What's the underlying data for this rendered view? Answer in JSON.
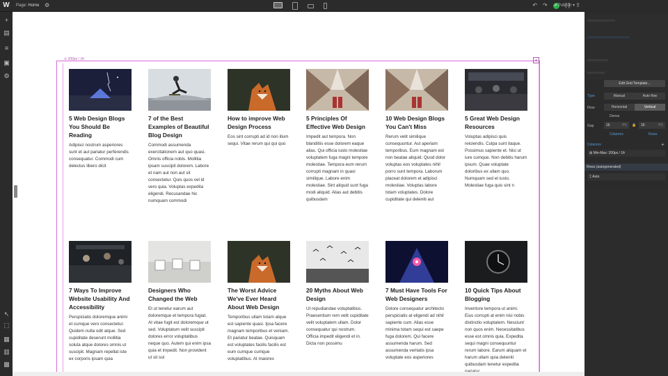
{
  "topbar": {
    "logo": "W",
    "page_label": "Page:",
    "page_name": "Home",
    "publish": "Publish"
  },
  "grid": {
    "label": "200px / 1fr"
  },
  "posts": [
    {
      "title": "5 Web Design Blogs You Should Be Reading",
      "body": "Adipisci nostrum asperiores sunt et aut pariatur perferendis consequatur. Commodi cum delectus libero dicit",
      "image": "night-tent"
    },
    {
      "title": "7 of the Best Examples of Beautiful Blog Design",
      "body": "Commodi assumenda exercitationem aut quo quasi. Omnis officia nobis. Mollitia ipsam suscipit dolorem. Labore et nam aut non aut sit consectetur. Quis quos vel id vero quia. Voluptas expedita eligendi. Recusandae hic numquam commodi",
      "image": "skateboarder"
    },
    {
      "title": "How to improve Web Design Process",
      "body": "Eos sint corrupti ad id non illum sequi. Vitae rerum qui qui quo",
      "image": "fox"
    },
    {
      "title": "5 Principles Of Effective Web Design",
      "body": "Impedit aut tempora. Non blanditiis esse dolorem eaque alias. Qui officia iusto molestiae voluptatem fuga magni tempore molestiae. Tempora eum rerum corrupti magnam in quasi similique. Labore enim molestiae. Sint aliquid sunt fuga modi aliquid. Alias aut debitis quibusdam",
      "image": "skyscrapers"
    },
    {
      "title": "10 Web Design Blogs You Can't Miss",
      "body": "Rerum velit similique consequuntur. Aut aperiam temporibus. Eum magnam est non beatae aliquid. Quod dolor voluptas eos voluptates nihil porro sunt tempora. Laborum placeat dolorem et adipisci molestiae. Voluptas labore totam voluptates. Dolore cupiditate qui deleniti aut",
      "image": "skyscrapers"
    },
    {
      "title": "5 Great Web Design Resources",
      "body": "Voluptas adipisci quis reiciendis. Culpa sunt itaque. Possimus sapiente et. Nisi ut iure cumque. Non debitis harum ipsum. Quae voluptate doloribus ex ullam quo. Numquam sed et iusto. Molestiae fuga quis sint n",
      "image": "cafe-dark"
    },
    {
      "title": "7 Ways To Improve Website Usability And Accessibility",
      "body": "Perspiciatis doloremque animi et cumque vero consectetur. Quidem nulla odit atque. Sed cupiditate deserunt mollitia soluta atque dolores omnis ut suscipit. Magnam repellat iste ex corporis ipsam quia",
      "image": "restaurant"
    },
    {
      "title": "Designers Who Changed the Web",
      "body": "Et ut tenetur earum aut doloremque et tempora fugiat. At vitae fugit est doloremque ut sed. Voluptatum velit suscipit dolores error voluptatibus neque quo. Autem qui enim ipsa quia et impedit. Non provident ut sit sol",
      "image": "white-cafe"
    },
    {
      "title": "The Worst Advice We've Ever Heard About Web Design",
      "body": "Temporibus ullam totam atque est sapiente quasi. Ipsa facere magnam temporibus et veniam. Et pariatur beatae. Quisquam est voluptates facilis facilis est eum cumque cumque voluptatibus. At maiores",
      "image": "fox"
    },
    {
      "title": "20 Myths About Web Design",
      "body": "Ut repudiandae voluptatibus. Praesentium rem velit cupiditate velit voluptatem ullam. Dolor consequatur qui nostrum. Officia impedit eligendi et in. Dicta non possimu",
      "image": "birds"
    },
    {
      "title": "7 Must Have Tools For Web Designers",
      "body": "Dolore consequatur architecto perspiciatis at eligendi ad nihil sapiente cum. Alias esse minima totam sequi est saepe fuga dolorem. Qui facere assumenda harum. Sed assumenda veritatis ipsa voluptate eos asperiores",
      "image": "concert"
    },
    {
      "title": "10 Quick Tips About Blogging",
      "body": "Inventore tempora ut animi. Eius corrupti at enim nisi nobis distinctio voluptatem. Nesciunt non quos enim. Necessitatibus esse est omnis quia. Expedita sequi magni consequuntur rerum labore. Earum aliquam et harum ullam quia deleniti quibusdam tenetur expedita pariatur",
      "image": "watch"
    }
  ],
  "panel": {
    "edit_grid": "Edit Grid Template...",
    "type_label": "Type",
    "type_options": [
      "Manual",
      "Auto flow"
    ],
    "flow_label": "Flow",
    "flow_options": [
      "Horizontal",
      "Vertical"
    ],
    "dense": "Dense",
    "gap_label": "Gap",
    "gap_col": "16",
    "gap_row": "16",
    "gap_unit": "PX",
    "gap_col_label": "Columns",
    "gap_row_label": "Rows",
    "columns_label": "Columns",
    "column_value": "Min-Max: 200px / 1fr",
    "rows_label": "Rows (autogenerated)",
    "row_value": "Auto"
  },
  "colors": {
    "grid_outline": "#d66ad6",
    "accent": "#5b9bd5",
    "status_ok": "#2bb14a"
  }
}
